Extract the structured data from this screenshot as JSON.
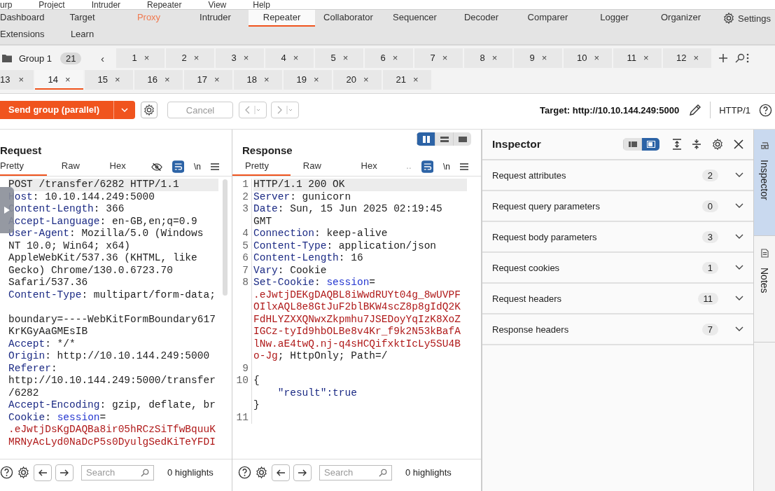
{
  "menu": [
    "urp",
    "Project",
    "Intruder",
    "Repeater",
    "View",
    "Help"
  ],
  "nav_rows": [
    {
      "tabs": [
        {
          "label": "Dashboard",
          "selected": false,
          "highlighted": false
        },
        {
          "label": "Target",
          "selected": false,
          "highlighted": false
        },
        {
          "label": "Proxy",
          "selected": false,
          "highlighted": true
        },
        {
          "label": "Intruder",
          "selected": false,
          "highlighted": false
        },
        {
          "label": "Repeater",
          "selected": true,
          "highlighted": false
        },
        {
          "label": "Collaborator",
          "selected": false,
          "highlighted": false
        },
        {
          "label": "Sequencer",
          "selected": false,
          "highlighted": false
        },
        {
          "label": "Decoder",
          "selected": false,
          "highlighted": false
        },
        {
          "label": "Comparer",
          "selected": false,
          "highlighted": false
        },
        {
          "label": "Logger",
          "selected": false,
          "highlighted": false
        },
        {
          "label": "Organizer",
          "selected": false,
          "highlighted": false
        }
      ]
    },
    {
      "tabs": [
        {
          "label": "Extensions",
          "selected": false,
          "highlighted": false
        },
        {
          "label": "Learn",
          "selected": false,
          "highlighted": false
        }
      ]
    }
  ],
  "settings": "Settings",
  "group": {
    "name": "Group 1",
    "count": "21",
    "prev": "‹"
  },
  "tab_rows": [
    {
      "tabs": [
        {
          "label": "1",
          "selected": false
        },
        {
          "label": "2",
          "selected": false
        },
        {
          "label": "3",
          "selected": false
        },
        {
          "label": "4",
          "selected": false
        },
        {
          "label": "5",
          "selected": false
        },
        {
          "label": "6",
          "selected": false
        },
        {
          "label": "7",
          "selected": false
        },
        {
          "label": "8",
          "selected": false
        },
        {
          "label": "9",
          "selected": false
        },
        {
          "label": "10",
          "selected": false
        },
        {
          "label": "11",
          "selected": false
        },
        {
          "label": "12",
          "selected": false
        }
      ]
    },
    {
      "tabs": [
        {
          "label": "13",
          "selected": false
        },
        {
          "label": "14",
          "selected": true
        },
        {
          "label": "15",
          "selected": false
        },
        {
          "label": "16",
          "selected": false
        },
        {
          "label": "17",
          "selected": false
        },
        {
          "label": "18",
          "selected": false
        },
        {
          "label": "19",
          "selected": false
        },
        {
          "label": "20",
          "selected": false
        },
        {
          "label": "21",
          "selected": false
        }
      ]
    }
  ],
  "tab_close": "×",
  "toolbar": {
    "send": "Send group (parallel)",
    "cancel": "Cancel",
    "cancel_disabled": true,
    "target": "Target: http://10.10.144.249:5000",
    "protocol": "HTTP/1"
  },
  "request": {
    "title": "Request",
    "tabs": [
      {
        "label": "Pretty",
        "selected": true
      },
      {
        "label": "Raw",
        "selected": false
      },
      {
        "label": "Hex",
        "selected": false
      }
    ],
    "newline": "\\n",
    "lines": [
      {
        "kind": "code",
        "current": true,
        "segs": [
          {
            "t": "POST /transfer/6282 HTTP/1.1",
            "kind": "plain"
          }
        ]
      },
      {
        "kind": "code",
        "current": false,
        "segs": [
          {
            "t": "Host",
            "kind": "key"
          },
          {
            "t": ": 10.10.144.249:5000",
            "kind": "plain"
          }
        ]
      },
      {
        "kind": "code",
        "current": false,
        "segs": [
          {
            "t": "Content-Length",
            "kind": "key"
          },
          {
            "t": ": 366",
            "kind": "plain"
          }
        ]
      },
      {
        "kind": "code",
        "current": false,
        "segs": [
          {
            "t": "Accept-Language",
            "kind": "key"
          },
          {
            "t": ": en-GB,en;q=0.9",
            "kind": "plain"
          }
        ]
      },
      {
        "kind": "code",
        "current": false,
        "segs": [
          {
            "t": "User-Agent",
            "kind": "key"
          },
          {
            "t": ": Mozilla/5.0 (Windows",
            "kind": "plain"
          }
        ]
      },
      {
        "kind": "code",
        "current": false,
        "segs": [
          {
            "t": "NT 10.0; Win64; x64)",
            "kind": "plain"
          }
        ]
      },
      {
        "kind": "code",
        "current": false,
        "segs": [
          {
            "t": "AppleWebKit/537.36 (KHTML, like",
            "kind": "plain"
          }
        ]
      },
      {
        "kind": "code",
        "current": false,
        "segs": [
          {
            "t": "Gecko) Chrome/130.0.6723.70",
            "kind": "plain"
          }
        ]
      },
      {
        "kind": "code",
        "current": false,
        "segs": [
          {
            "t": "Safari/537.36",
            "kind": "plain"
          }
        ]
      },
      {
        "kind": "code",
        "current": false,
        "segs": [
          {
            "t": "Content-Type",
            "kind": "key"
          },
          {
            "t": ": multipart/form-data;",
            "kind": "plain"
          }
        ]
      },
      {
        "kind": "blank"
      },
      {
        "kind": "code",
        "current": false,
        "segs": [
          {
            "t": "boundary=----WebKitFormBoundary617",
            "kind": "plain"
          }
        ]
      },
      {
        "kind": "code",
        "current": false,
        "segs": [
          {
            "t": "KrKGyAaGMEsIB",
            "kind": "plain"
          }
        ]
      },
      {
        "kind": "code",
        "current": false,
        "segs": [
          {
            "t": "Accept",
            "kind": "key"
          },
          {
            "t": ": */*",
            "kind": "plain"
          }
        ]
      },
      {
        "kind": "code",
        "current": false,
        "segs": [
          {
            "t": "Origin",
            "kind": "key"
          },
          {
            "t": ": http://10.10.144.249:5000",
            "kind": "plain"
          }
        ]
      },
      {
        "kind": "code",
        "current": false,
        "segs": [
          {
            "t": "Referer",
            "kind": "key"
          },
          {
            "t": ":",
            "kind": "plain"
          }
        ]
      },
      {
        "kind": "code",
        "current": false,
        "segs": [
          {
            "t": "http://10.10.144.249:5000/transfer",
            "kind": "plain"
          }
        ]
      },
      {
        "kind": "code",
        "current": false,
        "segs": [
          {
            "t": "/6282",
            "kind": "plain"
          }
        ]
      },
      {
        "kind": "code",
        "current": false,
        "segs": [
          {
            "t": "Accept-Encoding",
            "kind": "key"
          },
          {
            "t": ": gzip, deflate, br",
            "kind": "plain"
          }
        ]
      },
      {
        "kind": "code",
        "current": false,
        "segs": [
          {
            "t": "Cookie",
            "kind": "key"
          },
          {
            "t": ": ",
            "kind": "plain"
          },
          {
            "t": "session",
            "kind": "name"
          },
          {
            "t": "=",
            "kind": "plain"
          }
        ]
      },
      {
        "kind": "code",
        "current": false,
        "segs": [
          {
            "t": ".eJwtjDsKgDAQBa8ir05hRCzSiTfwBquuK",
            "kind": "value"
          }
        ]
      },
      {
        "kind": "code",
        "current": false,
        "segs": [
          {
            "t": "MRNyAcLyd0NaDcP5s0DyulgSedKiTeYFDI",
            "kind": "value"
          }
        ]
      }
    ],
    "search_placeholder": "Search",
    "highlights": "0 highlights"
  },
  "response": {
    "title": "Response",
    "tabs": [
      {
        "label": "Pretty",
        "selected": true
      },
      {
        "label": "Raw",
        "selected": false
      },
      {
        "label": "Hex",
        "selected": false
      }
    ],
    "more": "..",
    "newline": "\\n",
    "layout": [
      {
        "selected": true
      },
      {
        "selected": false
      },
      {
        "selected": false
      }
    ],
    "lines": [
      {
        "kind": "code",
        "num": "1",
        "current": true,
        "segs": [
          {
            "t": "HTTP/1.1 200 OK",
            "kind": "plain"
          }
        ]
      },
      {
        "kind": "code",
        "num": "2",
        "current": false,
        "segs": [
          {
            "t": "Server",
            "kind": "key"
          },
          {
            "t": ": gunicorn",
            "kind": "plain"
          }
        ]
      },
      {
        "kind": "code",
        "num": "3",
        "current": false,
        "segs": [
          {
            "t": "Date",
            "kind": "key"
          },
          {
            "t": ": Sun, 15 Jun 2025 02:19:45",
            "kind": "plain"
          }
        ]
      },
      {
        "kind": "code",
        "current": false,
        "segs": [
          {
            "t": "GMT",
            "kind": "plain"
          }
        ]
      },
      {
        "kind": "code",
        "num": "4",
        "current": false,
        "segs": [
          {
            "t": "Connection",
            "kind": "key"
          },
          {
            "t": ": keep-alive",
            "kind": "plain"
          }
        ]
      },
      {
        "kind": "code",
        "num": "5",
        "current": false,
        "segs": [
          {
            "t": "Content-Type",
            "kind": "key"
          },
          {
            "t": ": application/json",
            "kind": "plain"
          }
        ]
      },
      {
        "kind": "code",
        "num": "6",
        "current": false,
        "segs": [
          {
            "t": "Content-Length",
            "kind": "key"
          },
          {
            "t": ": 16",
            "kind": "plain"
          }
        ]
      },
      {
        "kind": "code",
        "num": "7",
        "current": false,
        "segs": [
          {
            "t": "Vary",
            "kind": "key"
          },
          {
            "t": ": Cookie",
            "kind": "plain"
          }
        ]
      },
      {
        "kind": "code",
        "num": "8",
        "current": false,
        "segs": [
          {
            "t": "Set-Cookie",
            "kind": "key"
          },
          {
            "t": ": ",
            "kind": "plain"
          },
          {
            "t": "session",
            "kind": "name"
          },
          {
            "t": "=",
            "kind": "plain"
          }
        ]
      },
      {
        "kind": "code",
        "current": false,
        "segs": [
          {
            "t": ".eJwtjDEKgDAQBL8iWwdRUYt04g_8wUVPF",
            "kind": "value"
          }
        ]
      },
      {
        "kind": "code",
        "current": false,
        "segs": [
          {
            "t": "OIlxAQL8e8GtJuF2blBKW4scZ8p8gIdQ2K",
            "kind": "value"
          }
        ]
      },
      {
        "kind": "code",
        "current": false,
        "segs": [
          {
            "t": "FdHLYZXXQNwxZkpmhu7JSEDoyYqIzK8XoZ",
            "kind": "value"
          }
        ]
      },
      {
        "kind": "code",
        "current": false,
        "segs": [
          {
            "t": "IGCz-tyId9hbOLBe8v4Kr_f9k2N53kBafA",
            "kind": "value"
          }
        ]
      },
      {
        "kind": "code",
        "current": false,
        "segs": [
          {
            "t": "lNw.aE4twQ.nj-q4sHCQifxktIcLy5SU4B",
            "kind": "value"
          }
        ]
      },
      {
        "kind": "code",
        "current": false,
        "segs": [
          {
            "t": "o-Jg",
            "kind": "value"
          },
          {
            "t": "; HttpOnly; Path=/",
            "kind": "plain"
          }
        ]
      },
      {
        "kind": "blank",
        "num": "9"
      },
      {
        "kind": "code",
        "num": "10",
        "current": false,
        "segs": [
          {
            "t": "{",
            "kind": "plain"
          }
        ]
      },
      {
        "kind": "code",
        "current": false,
        "segs": [
          {
            "t": "    \"result\":true",
            "kind": "json"
          }
        ]
      },
      {
        "kind": "code",
        "current": false,
        "segs": [
          {
            "t": "}",
            "kind": "plain"
          }
        ]
      },
      {
        "kind": "blank",
        "num": "11"
      }
    ],
    "search_placeholder": "Search",
    "highlights": "0 highlights"
  },
  "inspector": {
    "title": "Inspector",
    "layout": [
      {
        "selected": false
      },
      {
        "selected": true
      }
    ],
    "sections": [
      {
        "label": "Request attributes",
        "count": "2"
      },
      {
        "label": "Request query parameters",
        "count": "0"
      },
      {
        "label": "Request body parameters",
        "count": "3"
      },
      {
        "label": "Request cookies",
        "count": "1"
      },
      {
        "label": "Request headers",
        "count": "11"
      },
      {
        "label": "Response headers",
        "count": "7"
      }
    ]
  },
  "side_tabs": [
    {
      "label": "Inspector",
      "selected": true
    },
    {
      "label": "Notes",
      "selected": false
    }
  ]
}
